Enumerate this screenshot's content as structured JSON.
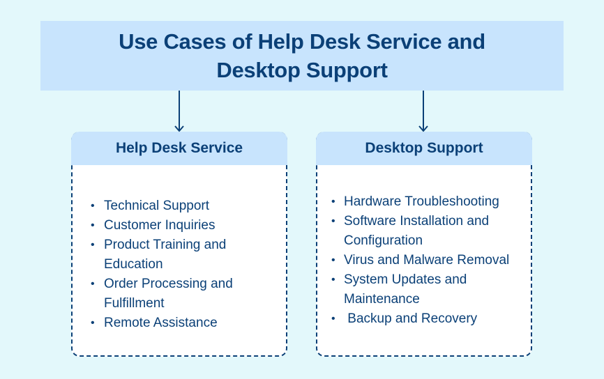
{
  "title": "Use Cases of Help Desk Service and Desktop Support",
  "colors": {
    "background": "#e3f8fb",
    "header_fill": "#c8e4fd",
    "text": "#0b4077",
    "card_fill": "#ffffff",
    "border": "#0b4077"
  },
  "cards": [
    {
      "heading": "Help Desk Service",
      "items": [
        "Technical Support",
        "Customer Inquiries",
        "Product Training and Education",
        "Order Processing and Fulfillment",
        "Remote Assistance"
      ]
    },
    {
      "heading": "Desktop Support",
      "items": [
        "Hardware Troubleshooting",
        "Software Installation and Configuration",
        "Virus and Malware Removal",
        "System Updates and Maintenance",
        " Backup and Recovery"
      ]
    }
  ],
  "bullet_glyph": "•"
}
